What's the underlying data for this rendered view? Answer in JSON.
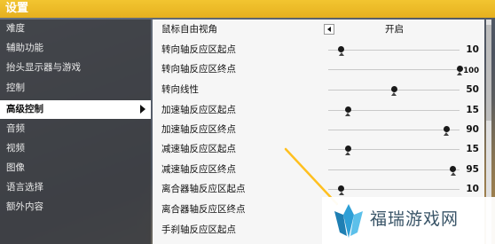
{
  "window": {
    "title": "设置"
  },
  "sidebar": {
    "items": [
      {
        "label": "难度",
        "active": false
      },
      {
        "label": "辅助功能",
        "active": false
      },
      {
        "label": "抬头显示器与游戏",
        "active": false
      },
      {
        "label": "控制",
        "active": false
      },
      {
        "label": "高级控制",
        "active": true
      },
      {
        "label": "音频",
        "active": false
      },
      {
        "label": "视频",
        "active": false
      },
      {
        "label": "图像",
        "active": false
      },
      {
        "label": "语言选择",
        "active": false
      },
      {
        "label": "额外内容",
        "active": false
      }
    ]
  },
  "settings": {
    "rows": [
      {
        "label": "鼠标自由视角",
        "type": "select",
        "value": "开启"
      },
      {
        "label": "转向轴反应区起点",
        "type": "slider",
        "value": "10",
        "level": 10
      },
      {
        "label": "转向轴反应区终点",
        "type": "slider",
        "value": "100",
        "level": 100
      },
      {
        "label": "转向线性",
        "type": "slider",
        "value": "50",
        "level": 50
      },
      {
        "label": "加速轴反应区起点",
        "type": "slider",
        "value": "15",
        "level": 15
      },
      {
        "label": "加速轴反应区终点",
        "type": "slider",
        "value": "90",
        "level": 90
      },
      {
        "label": "减速轴反应区起点",
        "type": "slider",
        "value": "15",
        "level": 15
      },
      {
        "label": "减速轴反应区终点",
        "type": "slider",
        "value": "95",
        "level": 95
      },
      {
        "label": "离合器轴反应区起点",
        "type": "slider",
        "value": "10",
        "level": 10
      },
      {
        "label": "离合器轴反应区终点",
        "type": "label"
      },
      {
        "label": "手刹轴反应区起点",
        "type": "label"
      }
    ]
  },
  "watermark": {
    "text": "福瑞游戏网"
  },
  "colors": {
    "accent": "#f0c02a",
    "active_bg": "#ffffff",
    "pointer": "#ffc020"
  }
}
